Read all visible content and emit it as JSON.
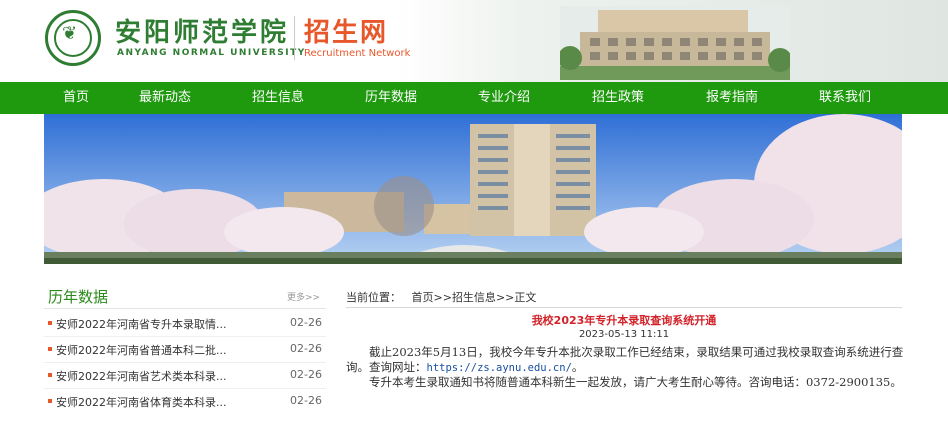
{
  "header": {
    "school_name_cn": "安阳师范学院",
    "school_name_en": "ANYANG NORMAL UNIVERSITY",
    "site_name_cn": "招生网",
    "site_name_en": "Recruitment Network"
  },
  "nav": {
    "items": [
      "首页",
      "最新动态",
      "招生信息",
      "历年数据",
      "专业介绍",
      "招生政策",
      "报考指南",
      "联系我们"
    ]
  },
  "sidebar": {
    "title": "历年数据",
    "more": "更多>>",
    "items": [
      {
        "title": "安师2022年河南省专升本录取情...",
        "date": "02-26"
      },
      {
        "title": "安师2022年河南省普通本科二批...",
        "date": "02-26"
      },
      {
        "title": "安师2022年河南省艺术类本科录...",
        "date": "02-26"
      },
      {
        "title": "安师2022年河南省体育类本科录...",
        "date": "02-26"
      }
    ]
  },
  "breadcrumb": {
    "label": "当前位置：",
    "items": [
      "首页",
      "招生信息",
      "正文"
    ],
    "separator": ">>"
  },
  "article": {
    "title": "我校2023年专升本录取查询系统开通",
    "date": "2023-05-13 11:11",
    "para1_text": "截止2023年5月13日，我校今年专升本批次录取工作已经结束，录取结果可通过我校录取查询系统进行查询。查询网址：",
    "url": "https://zs.aynu.edu.cn/",
    "para1_end": "。",
    "para2_text": "专升本考生录取通知书将随普通本科新生一起发放，请广大考生耐心等待。咨询电话：0372-2900135。"
  },
  "colors": {
    "nav_bg": "#1f9a0e",
    "brand_green": "#2e7d32",
    "accent_orange": "#e8572a",
    "title_red": "#d2232a"
  }
}
